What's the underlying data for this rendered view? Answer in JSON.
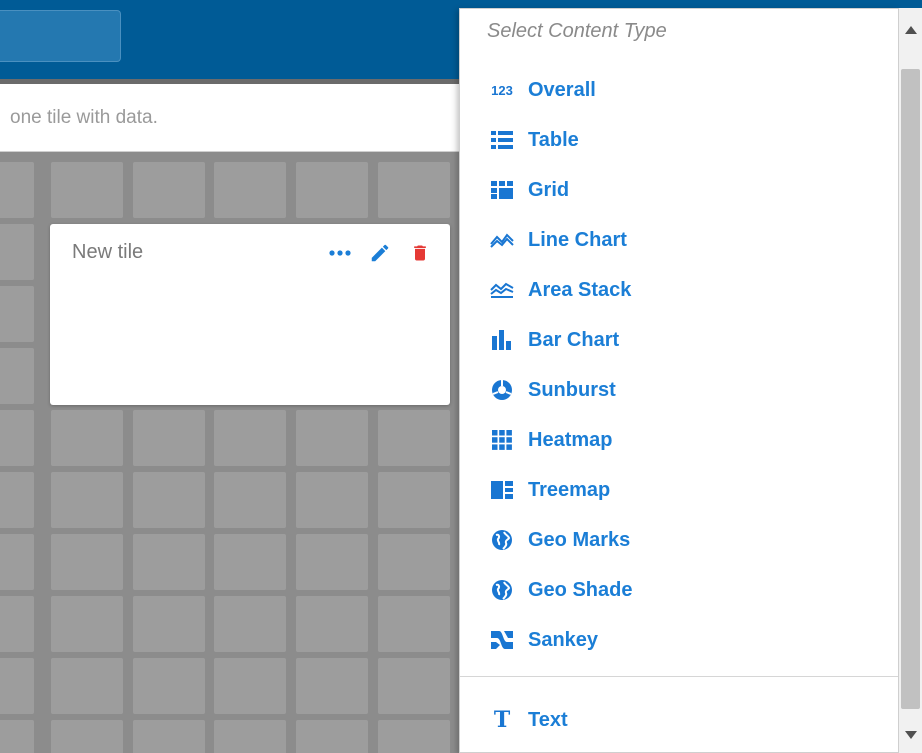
{
  "header": {
    "colors": {
      "bar": "#005b96",
      "accent": "#1b7ed6",
      "delete": "#e53935"
    }
  },
  "message": {
    "text": "one tile with data."
  },
  "tile": {
    "title": "New tile"
  },
  "dropdown": {
    "header": "Select Content Type",
    "items": [
      {
        "label": "Overall",
        "icon": "123-icon"
      },
      {
        "label": "Table",
        "icon": "table-icon"
      },
      {
        "label": "Grid",
        "icon": "grid-icon"
      },
      {
        "label": "Line Chart",
        "icon": "line-chart-icon"
      },
      {
        "label": "Area Stack",
        "icon": "area-stack-icon"
      },
      {
        "label": "Bar Chart",
        "icon": "bar-chart-icon"
      },
      {
        "label": "Sunburst",
        "icon": "sunburst-icon"
      },
      {
        "label": "Heatmap",
        "icon": "heatmap-icon"
      },
      {
        "label": "Treemap",
        "icon": "treemap-icon"
      },
      {
        "label": "Geo Marks",
        "icon": "globe-icon"
      },
      {
        "label": "Geo Shade",
        "icon": "globe-icon"
      },
      {
        "label": "Sankey",
        "icon": "sankey-icon"
      }
    ],
    "footer_item": {
      "label": "Text",
      "icon": "text-icon"
    },
    "overall_icon_text": "123",
    "text_icon_text": "T"
  }
}
